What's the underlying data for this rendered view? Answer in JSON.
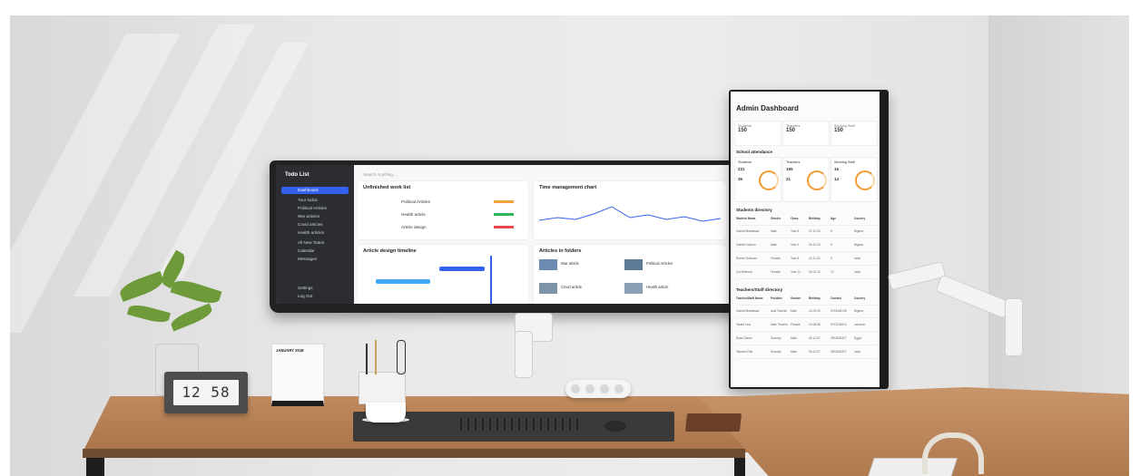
{
  "desk_clock": {
    "time": "12 58"
  },
  "calendar": {
    "header": "JANUARY 2018"
  },
  "ultrawide_monitor": {
    "app_logo": "Todo List",
    "sidebar_items": [
      "Dashboard",
      "Your todos",
      "Political Articles",
      "War articles",
      "Covid articles",
      "Health articles",
      "All New Todos",
      "Calendar",
      "Messages"
    ],
    "sidebar_footer": [
      "Settings",
      "Log Out"
    ],
    "search_placeholder": "Search Anything...",
    "panels": {
      "unfinished": "Unfinished work list",
      "time_chart": "Time management chart",
      "timeline": "Article design timeline",
      "folders": "Articles in folders"
    },
    "unfinished_items": [
      "Political Articles",
      "Health article",
      "Article design"
    ],
    "folder_items": [
      "War article",
      "Political Articles",
      "Covid article",
      "Health article"
    ]
  },
  "vertical_monitor": {
    "title": "Admin Dashboard",
    "stats": [
      {
        "label": "Students",
        "value": "150"
      },
      {
        "label": "Teachers",
        "value": "150"
      },
      {
        "label": "Working Staff",
        "value": "150"
      }
    ],
    "attendance_section": "School attendance",
    "attendance": [
      {
        "label": "Students",
        "present": "231",
        "absent": "35"
      },
      {
        "label": "Teachers",
        "present": "155",
        "absent": "21"
      },
      {
        "label": "Working Staff",
        "present": "16",
        "absent": "14"
      }
    ],
    "students_section": "Students directory",
    "students_headers": [
      "Student Name",
      "Gender",
      "Class",
      "Birthday",
      "Age",
      "Country"
    ],
    "students_rows": [
      [
        "Gabriel Bradshaw",
        "Male",
        "Year 8",
        "27-12-03",
        "8",
        "Nigeria"
      ],
      [
        "Gabriel Carbon",
        "Male",
        "Year 9",
        "20-12-03",
        "9",
        "Nigeria"
      ],
      [
        "Rachel Dolinsen",
        "Female",
        "Year 8",
        "13-11-02",
        "9",
        "India"
      ],
      [
        "Cia Bellevey",
        "Female",
        "Year 12",
        "24-03-10",
        "12",
        "India"
      ]
    ],
    "staff_section": "Teachers/Staff directory",
    "staff_headers": [
      "Teacher/Staff Name",
      "Position",
      "Gender",
      "Birthday",
      "Contact",
      "Country"
    ],
    "staff_rows": [
      [
        "Gabriel Bradshaw",
        "Asst Teacher",
        "Male",
        "12-03-90",
        "0703456738",
        "Nigeria"
      ],
      [
        "Tassid Lind",
        "Main Teacher",
        "Female",
        "10-08-88",
        "0702234512",
        "Lebanon"
      ],
      [
        "Ryan Glarke",
        "Security",
        "Male",
        "05-12-87",
        "0902845327",
        "Egypt"
      ],
      [
        "Tahmed Flair",
        "Security",
        "Male",
        "09-12-87",
        "0902845327",
        "India"
      ]
    ]
  }
}
